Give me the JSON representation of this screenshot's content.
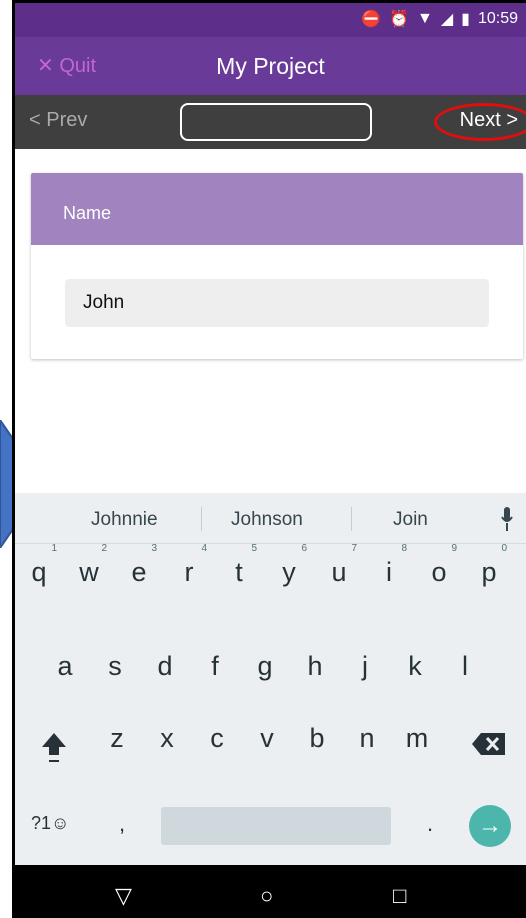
{
  "status_bar": {
    "time": "10:59"
  },
  "app_bar": {
    "quit_label": "✕ Quit",
    "title": "My Project"
  },
  "nav": {
    "prev_label": "< Prev",
    "next_label": "Next >"
  },
  "card": {
    "header": "Name",
    "field_value": "John"
  },
  "keyboard": {
    "suggestions": [
      "Johnnie",
      "Johnson",
      "Join"
    ],
    "row1": [
      {
        "key": "q",
        "hint": "1"
      },
      {
        "key": "w",
        "hint": "2"
      },
      {
        "key": "e",
        "hint": "3"
      },
      {
        "key": "r",
        "hint": "4"
      },
      {
        "key": "t",
        "hint": "5"
      },
      {
        "key": "y",
        "hint": "6"
      },
      {
        "key": "u",
        "hint": "7"
      },
      {
        "key": "i",
        "hint": "8"
      },
      {
        "key": "o",
        "hint": "9"
      },
      {
        "key": "p",
        "hint": "0"
      }
    ],
    "row2": [
      "a",
      "s",
      "d",
      "f",
      "g",
      "h",
      "j",
      "k",
      "l"
    ],
    "row3": [
      "z",
      "x",
      "c",
      "v",
      "b",
      "n",
      "m"
    ],
    "symbols_label": "?1☺",
    "comma": ",",
    "period": ".",
    "enter": "→"
  },
  "system_nav": {
    "back": "▽",
    "home": "○",
    "recent": "□"
  },
  "colors": {
    "appbar": "#6a3a98",
    "statusbar": "#5e2f8a",
    "card_header": "#a083bf",
    "highlight_ring": "#e20d0d",
    "enter_key": "#4db6ac",
    "arrow": "#4472c4"
  }
}
